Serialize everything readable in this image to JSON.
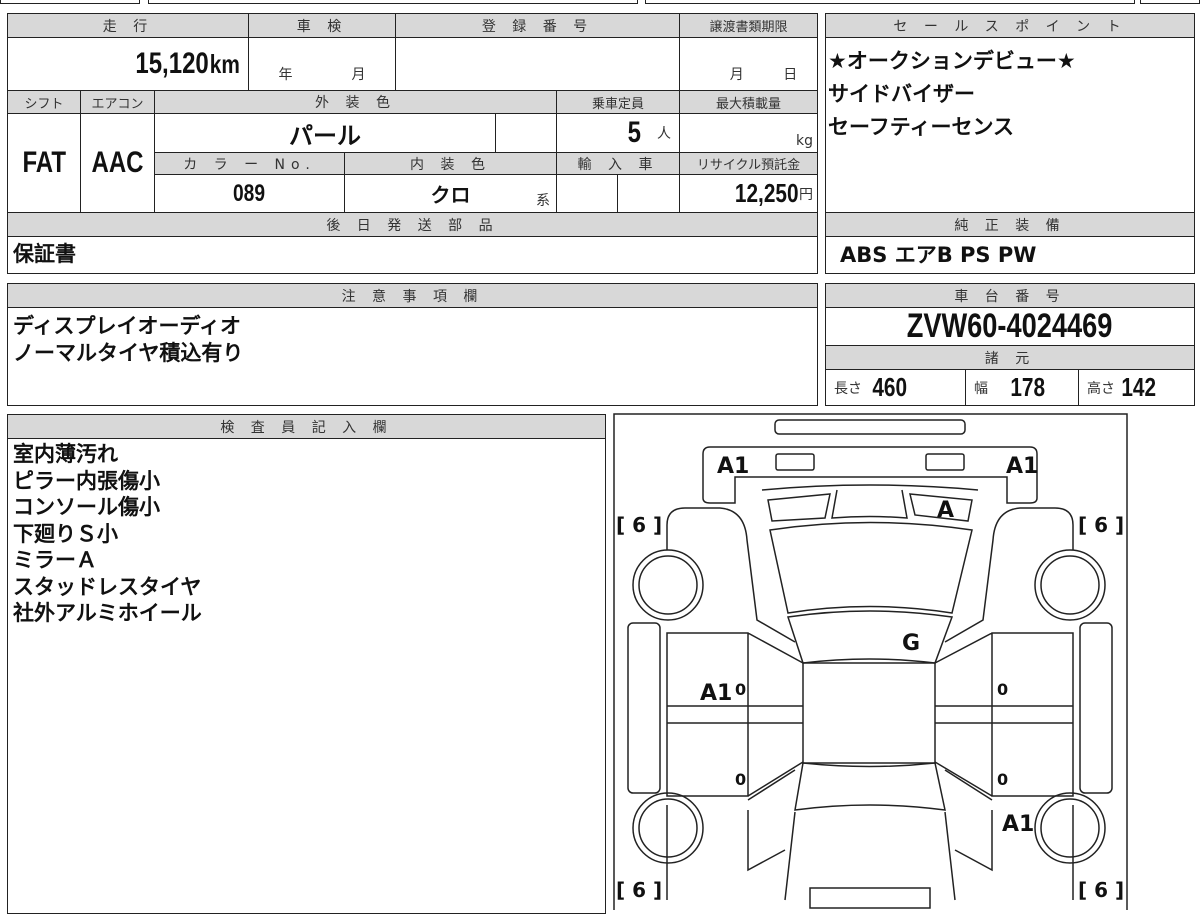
{
  "mileage": {
    "label": "走 行",
    "value": "15,120",
    "unit": "km"
  },
  "inspection": {
    "label": "車 検",
    "year": "年",
    "month": "月"
  },
  "registration": {
    "label": "登 録 番 号",
    "value": ""
  },
  "transfer_deadline": {
    "label": "譲渡書類期限",
    "month": "月",
    "day": "日"
  },
  "shift": {
    "label": "シフト",
    "value": "FAT"
  },
  "aircon": {
    "label": "エアコン",
    "value": "AAC"
  },
  "exterior_color": {
    "label": "外 装 色",
    "value": "パール"
  },
  "capacity": {
    "label": "乗車定員",
    "value": "5",
    "unit": "人"
  },
  "max_load": {
    "label": "最大積載量",
    "unit": "kg"
  },
  "color_no": {
    "label": "カ ラ ー No.",
    "value": "089"
  },
  "interior_color": {
    "label": "内 装 色",
    "value": "クロ",
    "suffix": "系"
  },
  "import": {
    "label": "輸 入 車"
  },
  "recycle_fee": {
    "label": "リサイクル預託金",
    "value": "12,250",
    "unit": "円"
  },
  "later_parts": {
    "label": "後 日 発 送 部 品",
    "value": "保証書"
  },
  "sales_points": {
    "label": "セ ー ル ス ポ イ ン ト",
    "items": [
      "★オークションデビュー★",
      "サイドバイザー",
      "セーフティーセンス"
    ]
  },
  "genuine_equipment": {
    "label": "純 正 装 備",
    "value": "ABS エアB PS PW"
  },
  "notes": {
    "label": "注 意 事 項 欄",
    "items": [
      "ディスプレイオーディオ",
      "ノーマルタイヤ積込有り"
    ]
  },
  "chassis": {
    "label": "車 台 番 号",
    "value": "ZVW60-4024469"
  },
  "specs": {
    "label": "諸 元",
    "length_label": "長さ",
    "length": "460",
    "width_label": "幅",
    "width": "178",
    "height_label": "高さ",
    "height": "142"
  },
  "inspector": {
    "label": "検 査 員 記 入 欄",
    "items": [
      "室内薄汚れ",
      "ピラー内張傷小",
      "コンソール傷小",
      "下廻りＳ小",
      "ミラーＡ",
      "スタッドレスタイヤ",
      "社外アルミホイール"
    ]
  },
  "diagram": {
    "marks": {
      "rear_left": "A1",
      "rear_right": "A1",
      "rear_glass": "A",
      "roof": "G",
      "left_door": "A1",
      "right_rear_fender": "A1",
      "door_lf": "0",
      "door_lr": "0",
      "door_rf": "0",
      "door_rr": "0"
    },
    "tread": {
      "rl": "[ 6 ]",
      "rr": "[ 6 ]",
      "fl": "[ 6 ]",
      "fr": "[ 6 ]"
    }
  }
}
